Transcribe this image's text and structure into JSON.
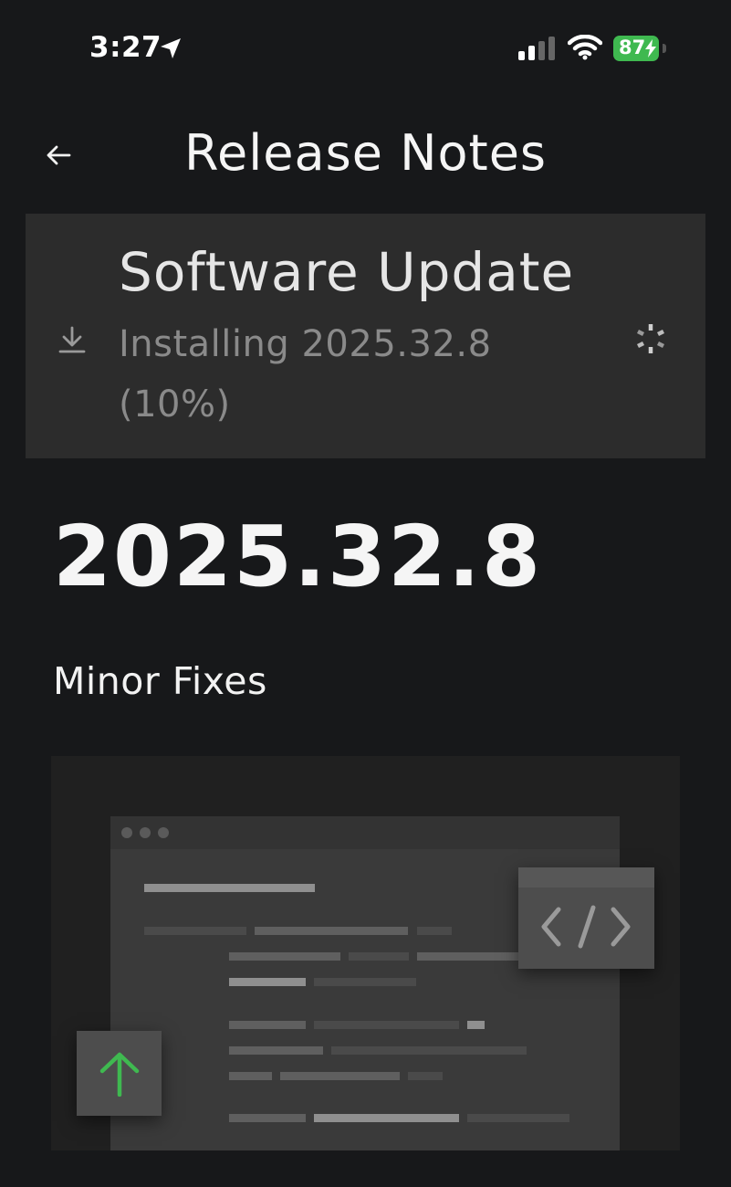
{
  "status_bar": {
    "time": "3:27",
    "battery_level": "87",
    "battery_color": "#3fb950",
    "icons": [
      "location-arrow-icon",
      "cellular-signal-icon",
      "wifi-icon",
      "battery-charging-icon"
    ]
  },
  "header": {
    "title": "Release Notes",
    "back_icon": "arrow-left-icon"
  },
  "update_card": {
    "title": "Software Update",
    "status": "Installing 2025.32.8 (10%)",
    "progress_percent": 10,
    "icons": [
      "download-icon",
      "spinner-icon"
    ]
  },
  "release": {
    "version": "2025.32.8",
    "section_title": "Minor Fixes"
  },
  "illustration": {
    "icons": [
      "code-brackets-icon",
      "upload-arrow-icon"
    ],
    "accent_color": "#3fb950"
  }
}
